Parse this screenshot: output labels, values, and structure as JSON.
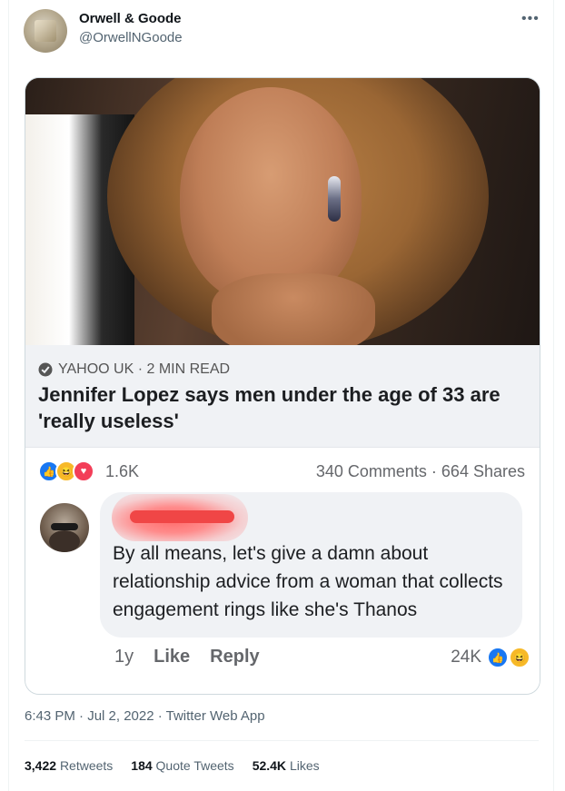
{
  "tweet": {
    "author_name": "Orwell & Goode",
    "author_handle": "@OrwellNGoode",
    "more_icon": "•••",
    "timestamp": "6:43 PM · Jul 2, 2022 · Twitter Web App",
    "metrics": {
      "retweets_count": "3,422",
      "retweets_label": "Retweets",
      "quote_count": "184",
      "quote_label": "Quote Tweets",
      "likes_count": "52.4K",
      "likes_label": "Likes"
    }
  },
  "embedded_post": {
    "source": "YAHOO UK · 2 MIN READ",
    "headline": "Jennifer Lopez says men under the age of 33 are 'really useless'",
    "reaction_count": "1.6K",
    "comments_shares": "340 Comments · 664 Shares",
    "comment": {
      "text": "By all means,  let's give a damn about relationship advice from a woman that collects engagement rings like she's Thanos",
      "age": "1y",
      "like_label": "Like",
      "reply_label": "Reply",
      "reaction_count": "24K"
    }
  }
}
